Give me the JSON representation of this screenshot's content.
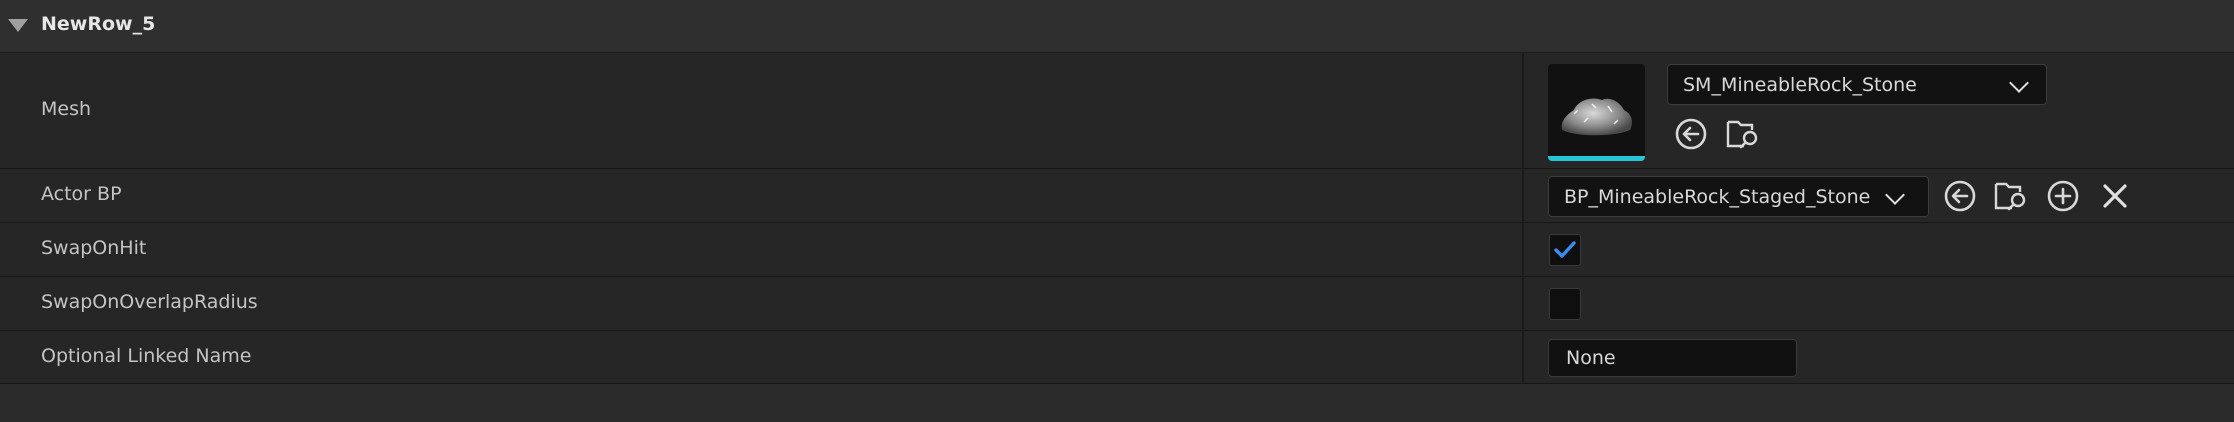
{
  "section": {
    "title": "NewRow_5"
  },
  "rows": {
    "mesh": {
      "label": "Mesh",
      "asset": "SM_MineableRock_Stone"
    },
    "actor_bp": {
      "label": "Actor BP",
      "asset": "BP_MineableRock_Staged_Stone"
    },
    "swap_on_hit": {
      "label": "SwapOnHit",
      "checked": true
    },
    "swap_on_overlap_radius": {
      "label": "SwapOnOverlapRadius",
      "checked": false
    },
    "optional_linked_name": {
      "label": "Optional Linked Name",
      "value": "None"
    }
  },
  "colors": {
    "accent": "#25c5d6",
    "check": "#3b8cf0",
    "background": "#262626"
  },
  "icons": [
    "collapse-triangle-icon",
    "chevron-down-icon",
    "use-selected-arrow-icon",
    "browse-folder-icon",
    "add-icon",
    "clear-x-icon",
    "checkmark-icon"
  ]
}
